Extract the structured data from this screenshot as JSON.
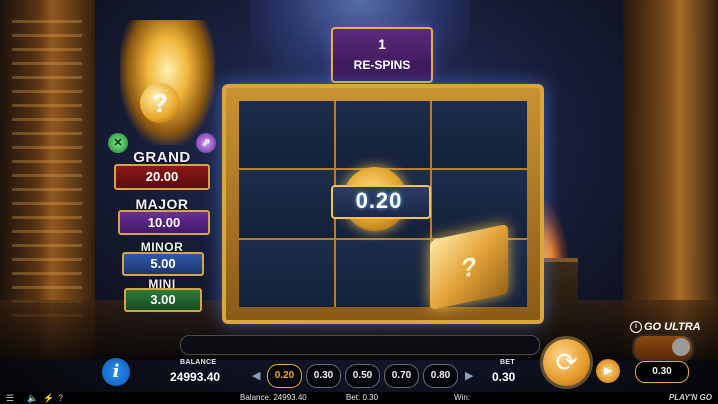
{
  "respins": {
    "count": "1",
    "label": "RE-SPINS"
  },
  "grid": {
    "coin_value": "0.20",
    "mystery_symbol": "?"
  },
  "idol": {
    "orb_symbol": "?",
    "left_gem": "✕",
    "right_gem": "⇗"
  },
  "jackpots": {
    "grand": {
      "label": "GRAND",
      "value": "20.00"
    },
    "major": {
      "label": "MAJOR",
      "value": "10.00"
    },
    "minor": {
      "label": "MINOR",
      "value": "5.00"
    },
    "mini": {
      "label": "MINI",
      "value": "3.00"
    }
  },
  "controls": {
    "info": "i",
    "balance_label": "BALANCE",
    "balance_value": "24993.40",
    "bet_label": "BET",
    "bet_value": "0.30",
    "bet_options": [
      "0.20",
      "0.30",
      "0.50",
      "0.70",
      "0.80"
    ],
    "selected_bet_option": "0.20",
    "go_ultra_label": "GO ULTRA",
    "go_ultra_value": "0.30"
  },
  "statusbar": {
    "balance": "Balance: 24993.40",
    "bet": "Bet: 0.30",
    "win": "Win:",
    "help": "?",
    "logo": "PLAY'N GO"
  }
}
